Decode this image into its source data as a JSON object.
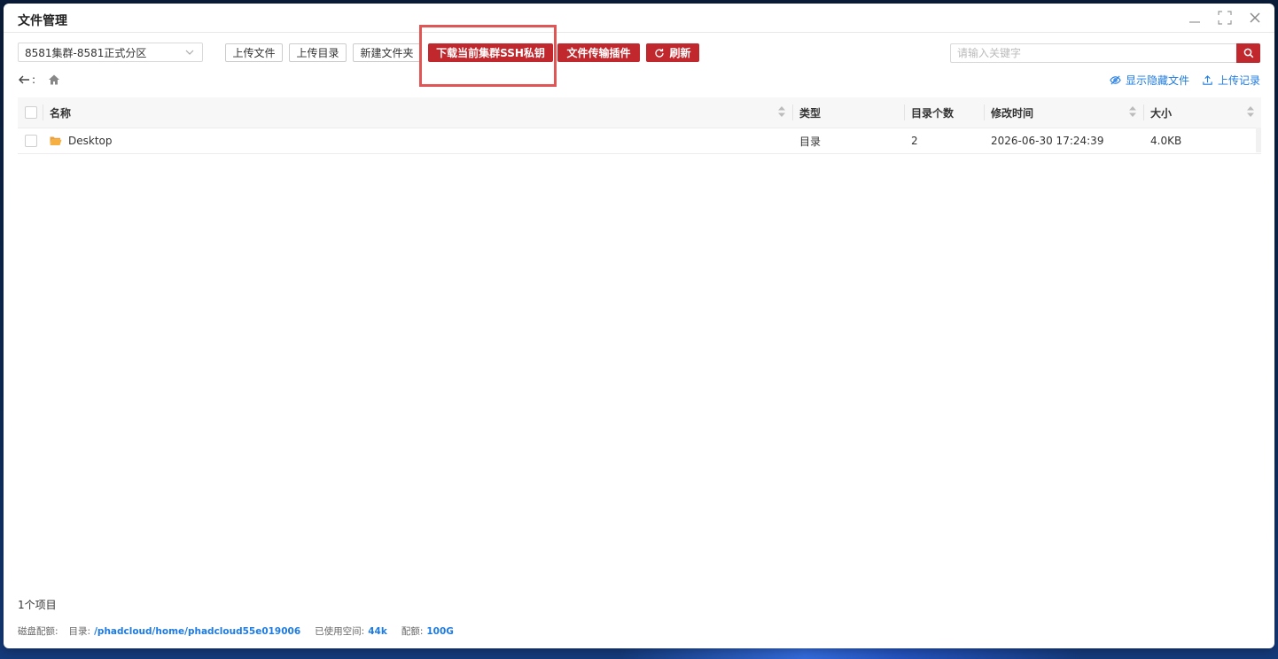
{
  "window": {
    "title": "文件管理"
  },
  "toolbar": {
    "cluster_value": "8581集群-8581正式分区",
    "upload_file": "上传文件",
    "upload_dir": "上传目录",
    "new_folder": "新建文件夹",
    "download_ssh_key": "下载当前集群SSH私钥",
    "transfer_plugin": "文件传输插件",
    "refresh": "刷新",
    "search_placeholder": "请输入关键字"
  },
  "nav": {
    "back_sep": ":",
    "show_hidden": "显示隐藏文件",
    "upload_history": "上传记录"
  },
  "table": {
    "columns": [
      "名称",
      "类型",
      "目录个数",
      "修改时间",
      "大小"
    ],
    "rows": [
      {
        "name": "Desktop",
        "type": "目录",
        "dir_count": "2",
        "mtime": "2026-06-30 17:24:39",
        "size": "4.0KB"
      }
    ]
  },
  "footer": {
    "item_count": "1个项目",
    "quota_label": "磁盘配额:",
    "dir_label": "目录:",
    "dir_value": "/phadcloud/home/phadcloud55e019006",
    "used_label": "已使用空间:",
    "used_value": "44k",
    "quota_value_label": "配额:",
    "quota_value": "100G"
  },
  "colors": {
    "accent_red": "#c0282d",
    "link_blue": "#1e7be0",
    "highlight": "#e05555",
    "folder": "#f5b041"
  }
}
